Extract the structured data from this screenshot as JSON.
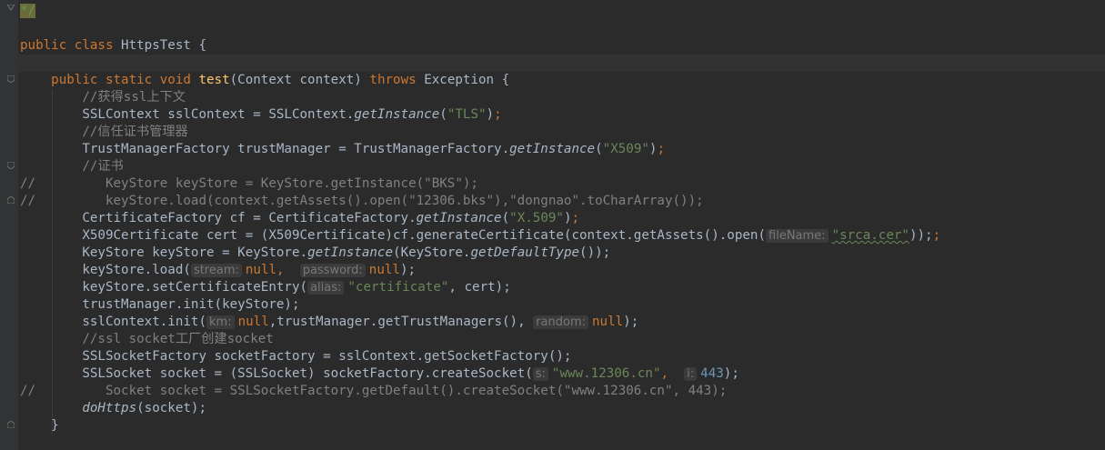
{
  "editor": {
    "lines": {
      "l0_comment_end": "*/",
      "l1_class_kw": "public class",
      "l1_class_name": "HttpsTest",
      "l1_brace": "{",
      "l2_method_kw": "public static void",
      "l2_method_name": "test",
      "l2_params": "(Context context)",
      "l2_throws": "throws",
      "l2_exc": "Exception {",
      "c_ssl": "//获得ssl上下文",
      "l_sslctx_a": "SSLContext sslContext = SSLContext.",
      "l_sslctx_m": "getInstance",
      "l_sslctx_s": "\"TLS\"",
      "c_trust": "//信任证书管理器",
      "l_tmf_a": "TrustManagerFactory trustManager = TrustManagerFactory.",
      "l_tmf_m": "getInstance",
      "l_tmf_s": "\"X509\"",
      "c_cert": "//证书",
      "cl1_prefix": "//",
      "cl1_text": "KeyStore keyStore = KeyStore.getInstance(\"BKS\");",
      "cl2_prefix": "//",
      "cl2_text": "keyStore.load(context.getAssets().open(\"12306.bks\"),\"dongnao\".toCharArray());",
      "l_cf_a": "CertificateFactory cf = CertificateFactory.",
      "l_cf_m": "getInstance",
      "l_cf_s": "\"X.509\"",
      "l_x509_a": "X509Certificate cert = (X509Certificate)cf.generateCertificate(context.getAssets().open(",
      "l_x509_hint": "fileName:",
      "l_x509_s": "\"srca.cer\"",
      "l_x509_end": "));",
      "l_ks_a": "KeyStore keyStore = KeyStore.",
      "l_ks_m1": "getInstance",
      "l_ks_b": "(KeyStore.",
      "l_ks_m2": "getDefaultType",
      "l_ks_end": "());",
      "l_load_a": "keyStore.load(",
      "l_load_h1": "stream:",
      "l_load_n1": "null",
      "l_load_h2": "password:",
      "l_load_n2": "null",
      "l_load_end": ");",
      "l_set_a": "keyStore.setCertificateEntry(",
      "l_set_hint": "alias:",
      "l_set_s": "\"certificate\"",
      "l_set_end": ", cert);",
      "l_tminit": "trustManager.init(keyStore);",
      "l_sslinit_a": "sslContext.init(",
      "l_sslinit_h1": "km:",
      "l_sslinit_n1": "null",
      "l_sslinit_b": ",trustManager.getTrustManagers(),",
      "l_sslinit_h2": "random:",
      "l_sslinit_n2": "null",
      "l_sslinit_end": ");",
      "c_factory": "//ssl socket工厂创建socket",
      "l_sf": "SSLSocketFactory socketFactory = sslContext.getSocketFactory();",
      "l_sock_a": "SSLSocket socket = (SSLSocket) socketFactory.createSocket(",
      "l_sock_h1": "s:",
      "l_sock_s": "\"www.12306.cn\"",
      "l_sock_comma": ",",
      "l_sock_h2": "i:",
      "l_sock_n": "443",
      "l_sock_end": ");",
      "cl3_prefix": "//",
      "cl3_text": "Socket socket = SSLSocketFactory.getDefault().createSocket(\"www.12306.cn\", 443);",
      "l_do_m": "doHttps",
      "l_do_end": "(socket);",
      "l_close": "}"
    }
  }
}
